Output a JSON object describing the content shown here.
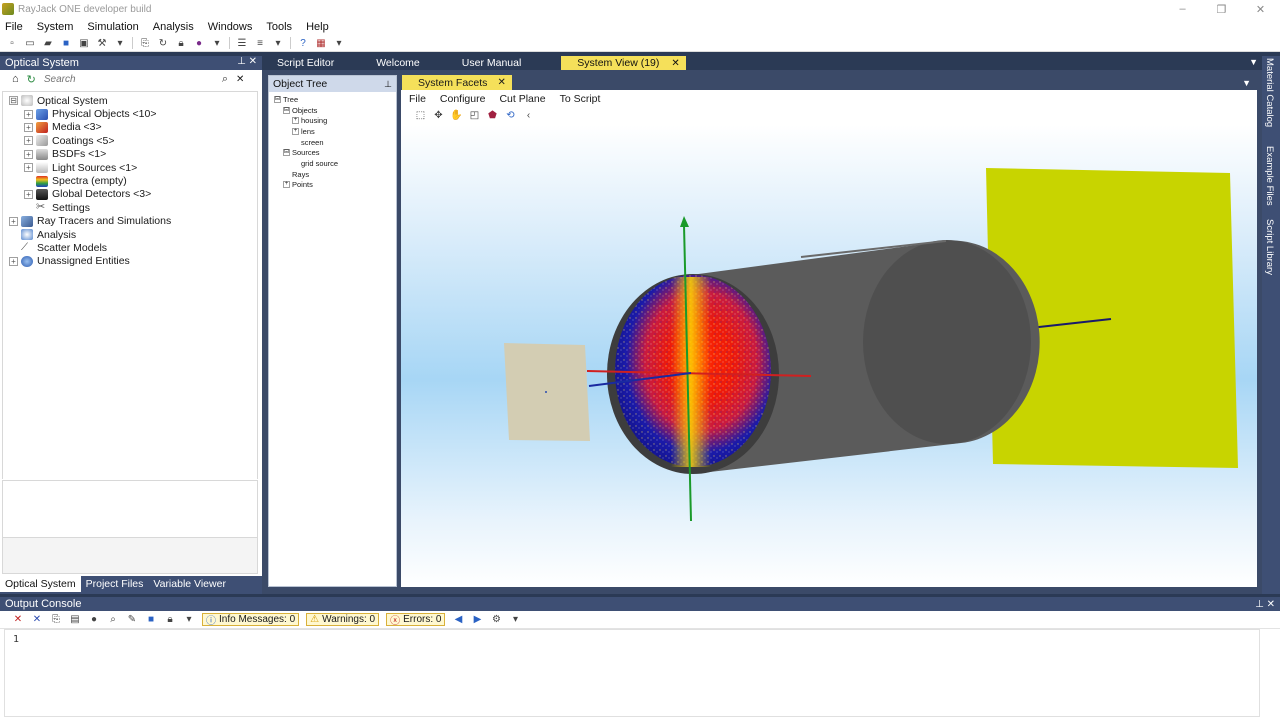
{
  "window": {
    "title": "RayJack ONE developer build",
    "controls": [
      "–",
      "❐",
      "✕"
    ]
  },
  "menu": [
    "File",
    "System",
    "Simulation",
    "Analysis",
    "Windows",
    "Tools",
    "Help"
  ],
  "left_panel": {
    "title": "Optical System",
    "search_placeholder": "Search",
    "tree": [
      {
        "label": "Optical System",
        "level": 0,
        "expander": "⊟"
      },
      {
        "label": "Physical Objects <10>",
        "level": 1,
        "expander": "+"
      },
      {
        "label": "Media <3>",
        "level": 1,
        "expander": "+"
      },
      {
        "label": "Coatings <5>",
        "level": 1,
        "expander": "+"
      },
      {
        "label": "BSDFs <1>",
        "level": 1,
        "expander": "+"
      },
      {
        "label": "Light Sources <1>",
        "level": 1,
        "expander": "+"
      },
      {
        "label": "Spectra (empty)",
        "level": 1,
        "expander": ""
      },
      {
        "label": "Global Detectors <3>",
        "level": 1,
        "expander": "+"
      },
      {
        "label": "Settings",
        "level": 1,
        "expander": ""
      },
      {
        "label": "Ray Tracers and Simulations",
        "level": 0,
        "expander": "+"
      },
      {
        "label": "Analysis",
        "level": 0,
        "expander": ""
      },
      {
        "label": "Scatter Models",
        "level": 0,
        "expander": ""
      },
      {
        "label": "Unassigned Entities",
        "level": 0,
        "expander": "+"
      }
    ],
    "tabs": [
      "Optical System",
      "Project Files",
      "Variable Viewer"
    ]
  },
  "doc_tabs": [
    "Script Editor",
    "Welcome",
    "User Manual"
  ],
  "active_doc_tab": "System View (19)",
  "object_tree": {
    "title": "Object Tree",
    "nodes": [
      {
        "label": "Tree",
        "level": 0,
        "expander": "⊟"
      },
      {
        "label": "Objects",
        "level": 1,
        "expander": "⊟"
      },
      {
        "label": "housing",
        "level": 2,
        "expander": "+"
      },
      {
        "label": "lens",
        "level": 2,
        "expander": "+"
      },
      {
        "label": "screen",
        "level": 2,
        "expander": ""
      },
      {
        "label": "Sources",
        "level": 1,
        "expander": "⊟"
      },
      {
        "label": "grid source",
        "level": 2,
        "expander": ""
      },
      {
        "label": "Rays",
        "level": 1,
        "expander": ""
      },
      {
        "label": "Points",
        "level": 1,
        "expander": "+"
      }
    ]
  },
  "system_facets": {
    "tab": "System Facets",
    "menu": [
      "File",
      "Configure",
      "Cut Plane",
      "To Script"
    ]
  },
  "right_strip": [
    "Material Catalog",
    "Example Files",
    "Script Library"
  ],
  "output_console": {
    "title": "Output Console",
    "info": "Info Messages: 0",
    "warnings": "Warnings: 0",
    "errors": "Errors: 0",
    "line_number": "1"
  },
  "colors": {
    "accent": "#f5e05a",
    "panel_header": "#3e4f74",
    "screen": "#c8d400",
    "housing": "#5a5a5a"
  }
}
